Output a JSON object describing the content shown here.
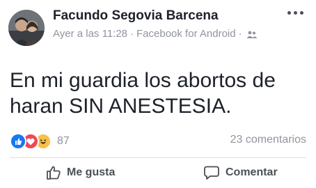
{
  "post": {
    "author": "Facundo Segovia Barcena",
    "timestamp": "Ayer a las 11:28",
    "separator": "·",
    "source": "Facebook for Android",
    "audience_icon": "friends-icon",
    "text_line1": "En mi guardia los abortos de",
    "text_line2": "haran SIN ANESTESIA."
  },
  "reactions": {
    "icons": [
      "like-icon",
      "love-icon",
      "haha-icon"
    ],
    "count": "87",
    "comments": "23 comentarios"
  },
  "actions": {
    "like_label": "Me gusta",
    "comment_label": "Comentar"
  },
  "colors": {
    "like_blue": "#1877f2",
    "love_red": "#ed4956",
    "haha_yellow": "#f7c04a",
    "meta_gray": "#90949c"
  }
}
